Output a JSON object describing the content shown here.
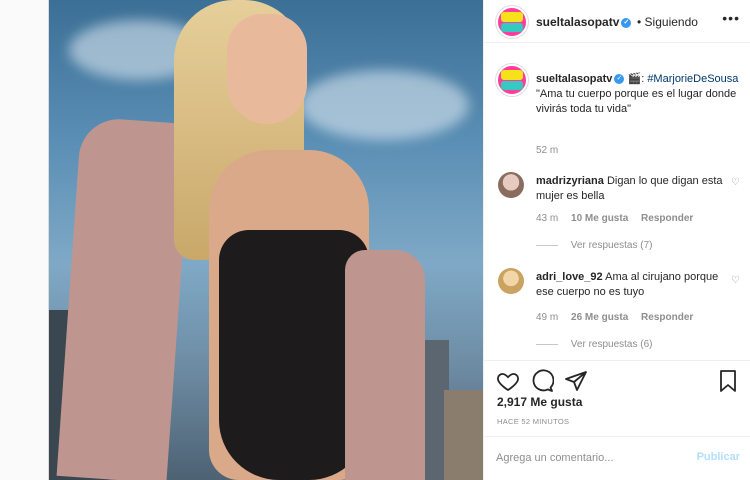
{
  "header": {
    "username": "sueltalasopatv",
    "separator": "•",
    "follow_status": "Siguiendo",
    "more": "•••"
  },
  "caption": {
    "username": "sueltalasopatv",
    "emoji": "🎬",
    "hashtag": "#MarjorieDeSousa",
    "text": " \"Ama tu cuerpo porque es el lugar donde vivirás toda tu vida\"",
    "time": "52 m"
  },
  "comments": [
    {
      "username": "madrizyriana",
      "text": "Digan lo que digan esta mujer es bella",
      "time": "43 m",
      "likes": "10 Me gusta",
      "reply": "Responder",
      "replies": "Ver respuestas (7)"
    },
    {
      "username": "adri_love_92",
      "text": "Ama al cirujano porque ese cuerpo no es tuyo",
      "time": "49 m",
      "likes": "26 Me gusta",
      "reply": "Responder",
      "replies": "Ver respuestas (6)"
    }
  ],
  "actions": {
    "likes": "2,917 Me gusta",
    "posted_ago": "HACE 52 MINUTOS"
  },
  "comment_box": {
    "placeholder": "Agrega un comentario...",
    "publish": "Publicar"
  },
  "icons": [
    "heart-icon",
    "comment-icon",
    "share-icon",
    "bookmark-icon",
    "verified-icon",
    "more-options-icon"
  ],
  "colors": {
    "verified": "#3897f0",
    "hashtag": "#00376b",
    "publish_disabled": "#b2dffc"
  }
}
